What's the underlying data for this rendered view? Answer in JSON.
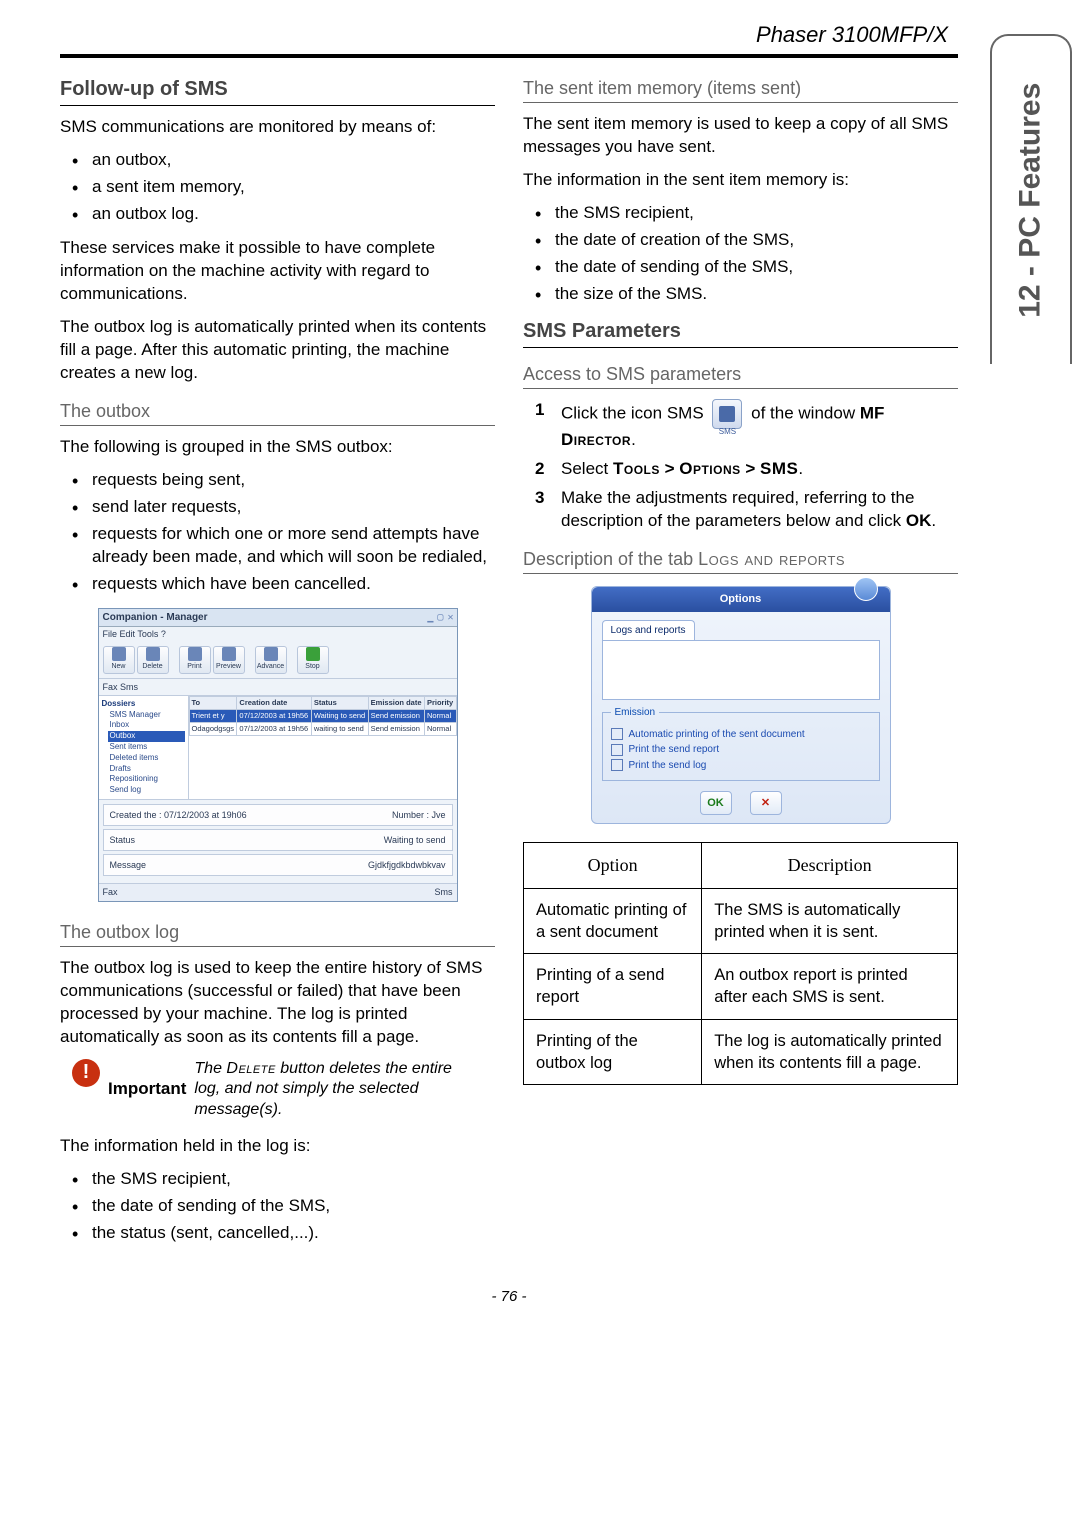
{
  "header": {
    "product": "Phaser 3100MFP/X"
  },
  "side_tab": "12 - PC Features",
  "left": {
    "h_followup": "Follow-up of SMS",
    "p_intro": "SMS communications are monitored by means of:",
    "intro_items": [
      "an outbox,",
      "a sent item memory,",
      "an outbox log."
    ],
    "p_services": "These services make it possible to have complete information on the machine activity with regard to communications.",
    "p_autoprint": "The outbox log is automatically printed when its contents fill a page. After this automatic printing, the machine creates a new log.",
    "h_outbox": "The outbox",
    "p_outbox_intro": "The following is grouped in the SMS outbox:",
    "outbox_items": [
      "requests being sent,",
      "send later requests,",
      "requests for which one or more send attempts have already been made, and which will soon be redialed,",
      "requests which have been cancelled."
    ],
    "fig_app": {
      "title": "Companion - Manager",
      "menus": "File   Edit   Tools   ?",
      "toolbar": [
        "New",
        "Delete",
        "Print",
        "Preview",
        "Advance",
        "Stop"
      ],
      "tabs": "Fax   Sms",
      "tree_title": "Dossiers",
      "tree": [
        "SMS Manager",
        " Inbox",
        " Outbox",
        " Sent items",
        " Deleted items",
        " Drafts",
        " Repositioning",
        " Send log"
      ],
      "tree_sel_index": 2,
      "grid_headers": [
        "To",
        "Creation date",
        "Status",
        "Emission date",
        "Priority"
      ],
      "grid_rows": [
        [
          "Trient et y",
          "07/12/2003 at 19h56",
          "Waiting to send",
          "Send emission",
          "Normal"
        ],
        [
          "Odagodgsgs",
          "07/12/2003 at 19h56",
          "waiting to send",
          "Send emission",
          "Normal"
        ]
      ],
      "detail_created": "Created the : 07/12/2003 at 19h06",
      "detail_number": "Number : Jve",
      "detail_status_lbl": "Status",
      "detail_status_val": "Waiting to send",
      "detail_msg_lbl": "Message",
      "detail_msg_val": "Gjdkfjgdkbdwbkvav",
      "footer": [
        "Fax",
        "Sms"
      ]
    },
    "h_outboxlog": "The outbox log",
    "p_outboxlog": "The outbox log is used to keep the entire history of SMS communications (successful or failed) that have been processed by your machine. The log is printed automatically as soon as its contents fill a page.",
    "imp_label": "Important",
    "imp_text_1": "The ",
    "imp_text_del": "Delete",
    "imp_text_2": " button deletes the entire log, and not simply the selected message(s).",
    "p_loginfo": "The information held in the log is:",
    "loginfo_items": [
      "the SMS recipient,",
      "the date of sending of the SMS,",
      "the status (sent, cancelled,...)."
    ]
  },
  "right": {
    "h_sentmem": "The sent item memory (items sent)",
    "p_sentmem": "The sent item memory is used to keep a copy of all SMS messages you have sent.",
    "p_sentinfo": "The information in the sent item memory is:",
    "sent_items": [
      "the SMS recipient,",
      "the date of creation of the SMS,",
      "the date of sending of the SMS,",
      "the size of the SMS."
    ],
    "h_smsparams": "SMS Parameters",
    "h_access": "Access to SMS parameters",
    "step1_a": "Click the icon SMS",
    "step1_b": " of the window ",
    "step1_mf": "MF ",
    "step1_dir": "Director",
    "step1_dot": ".",
    "step2_a": "Select ",
    "step2_tools": "Tools",
    "step2_gt1": " > ",
    "step2_options": "Options",
    "step2_gt2": " > ",
    "step2_sms": "SMS",
    "step2_dot": ".",
    "step3": "Make the adjustments required, referring to the description of the parameters below and click ",
    "step3_ok": "OK",
    "step3_dot": ".",
    "h_desc": "Description of the tab ",
    "h_desc_sc": "Logs and reports",
    "options_fig": {
      "title": "Options",
      "tab": "Logs and reports",
      "legend": "Emission",
      "chks": [
        "Automatic printing of the sent document",
        "Print the send report",
        "Print the send log"
      ],
      "ok": "OK",
      "x": "✕"
    },
    "table": {
      "h1": "Option",
      "h2": "Description",
      "rows": [
        [
          "Automatic printing of a sent document",
          "The SMS is automatically printed when it is sent."
        ],
        [
          "Printing of a send report",
          "An outbox report is printed after each SMS is sent."
        ],
        [
          "Printing of the outbox log",
          "The log is automatically printed when its contents fill a page."
        ]
      ]
    }
  },
  "page_num": "- 76 -",
  "icon_sms_label": "SMS"
}
